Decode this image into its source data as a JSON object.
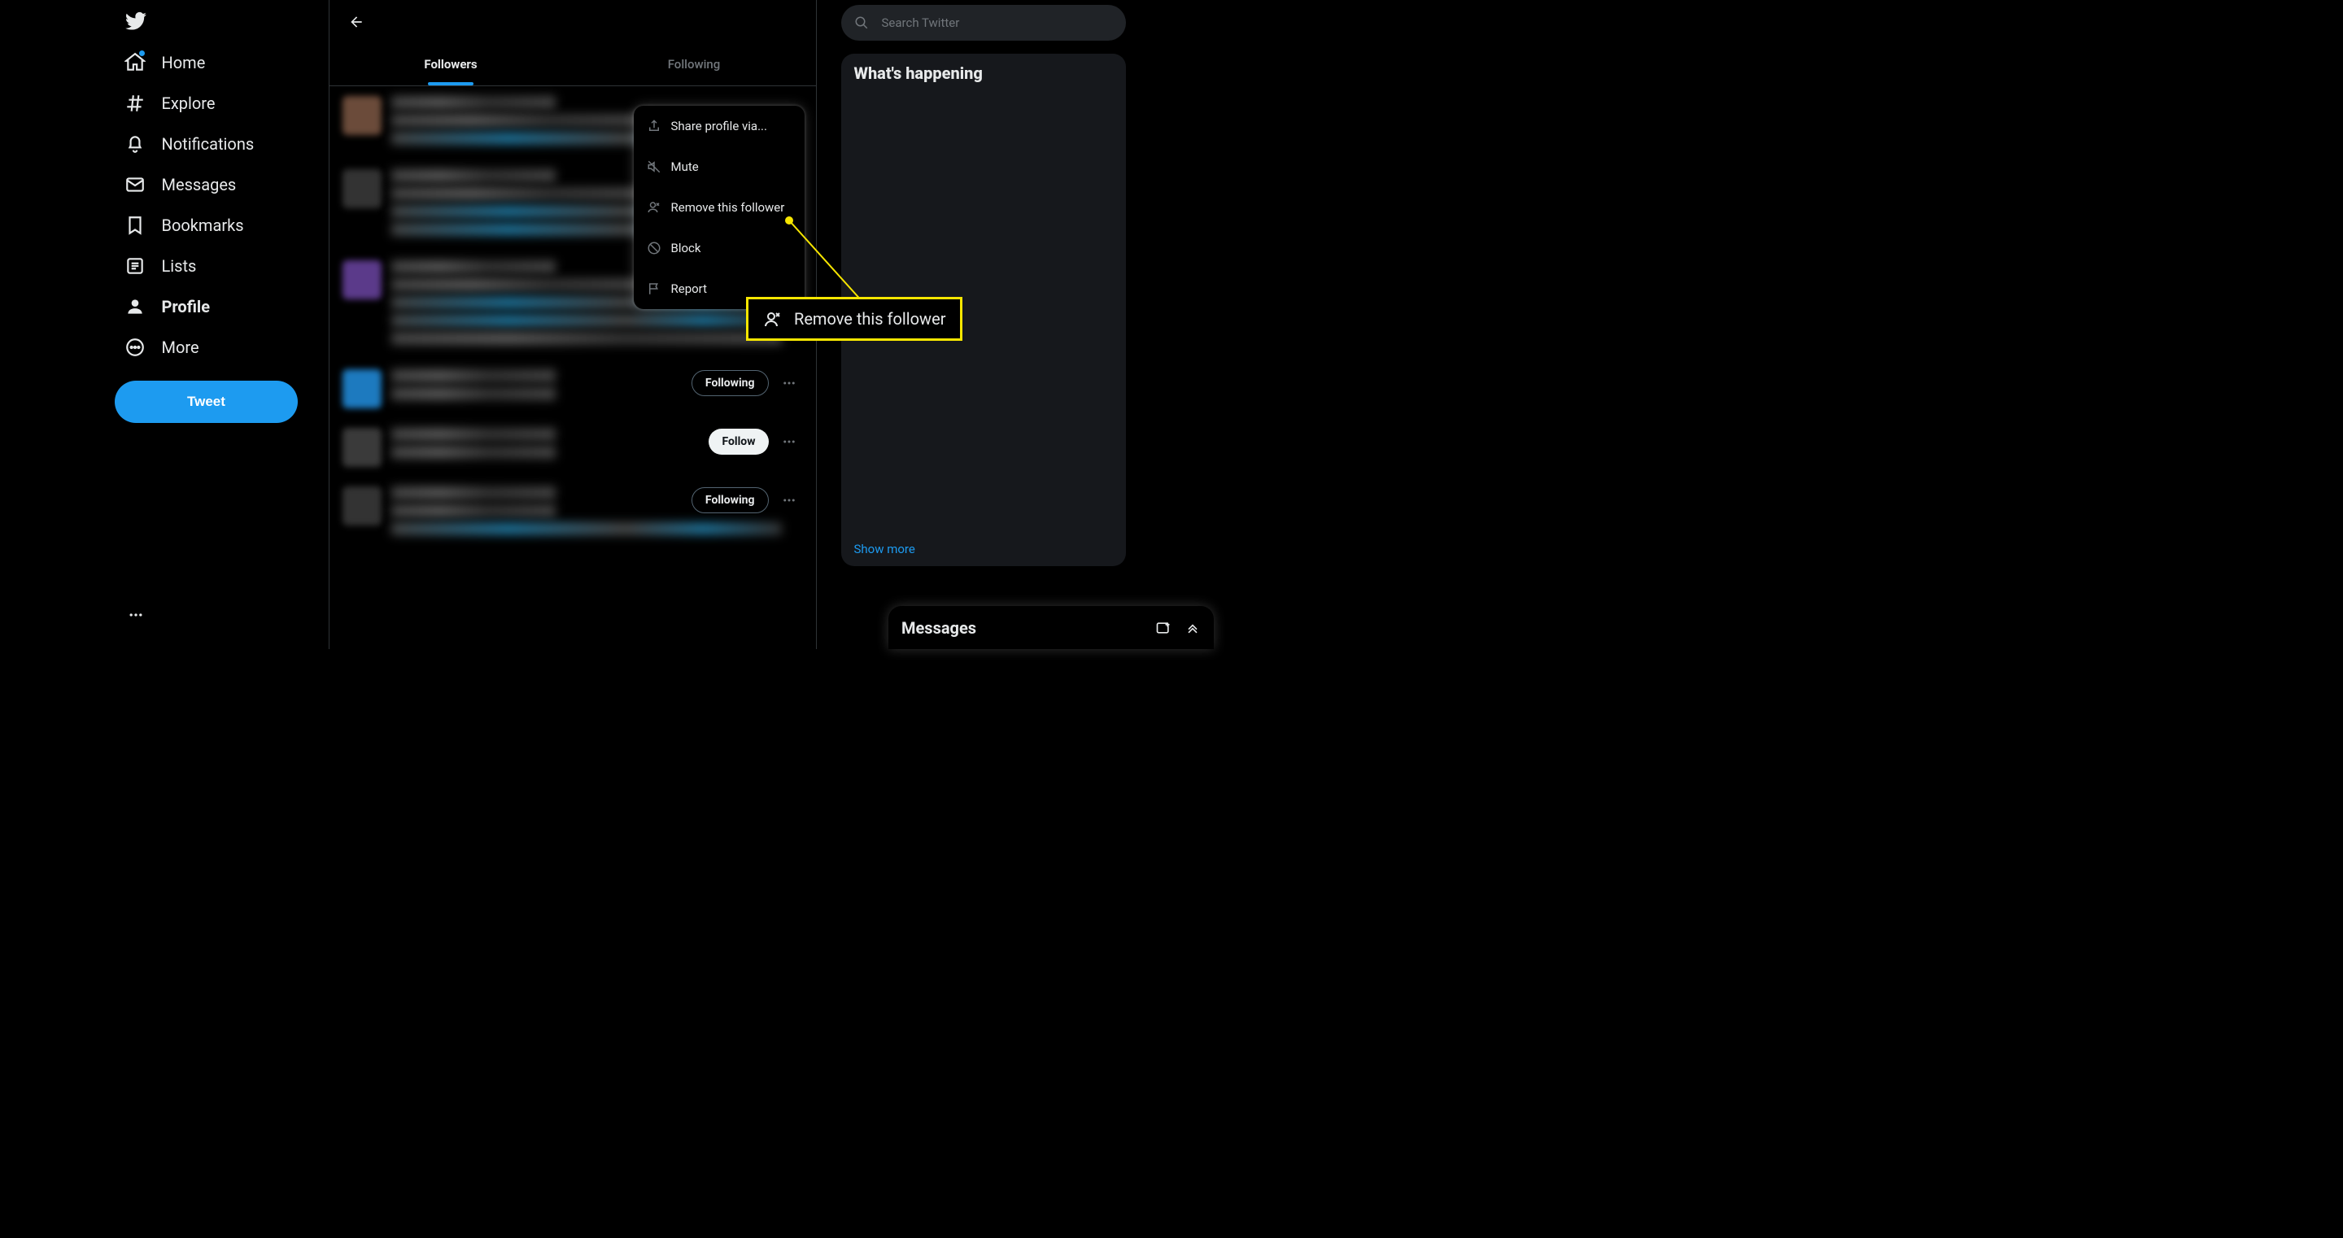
{
  "nav": {
    "home": "Home",
    "explore": "Explore",
    "notifications": "Notifications",
    "messages": "Messages",
    "bookmarks": "Bookmarks",
    "lists": "Lists",
    "profile": "Profile",
    "more": "More",
    "tweet": "Tweet"
  },
  "tabs": {
    "followers": "Followers",
    "following": "Following"
  },
  "menu": {
    "share": "Share profile via...",
    "mute": "Mute",
    "remove": "Remove this follower",
    "block": "Block",
    "report": "Report"
  },
  "callout": {
    "label": "Remove this follower"
  },
  "buttons": {
    "follow": "Follow",
    "following": "Following"
  },
  "search": {
    "placeholder": "Search Twitter"
  },
  "widget": {
    "title": "What's happening",
    "show_more": "Show more"
  },
  "dock": {
    "title": "Messages"
  }
}
